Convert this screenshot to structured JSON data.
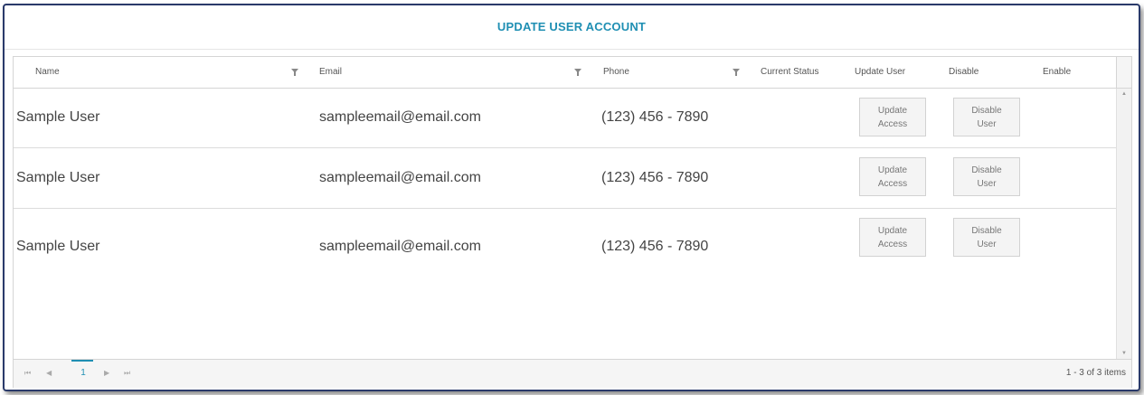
{
  "title": "UPDATE USER ACCOUNT",
  "columns": {
    "name": "Name",
    "email": "Email",
    "phone": "Phone",
    "status": "Current Status",
    "update": "Update User",
    "disable": "Disable",
    "enable": "Enable"
  },
  "rows": [
    {
      "name": "Sample User",
      "email": "sampleemail@email.com",
      "phone": "(123) 456 - 7890",
      "update_l1": "Update",
      "update_l2": "Access",
      "disable_l1": "Disable",
      "disable_l2": "User"
    },
    {
      "name": "Sample User",
      "email": "sampleemail@email.com",
      "phone": "(123) 456 - 7890",
      "update_l1": "Update",
      "update_l2": "Access",
      "disable_l1": "Disable",
      "disable_l2": "User"
    },
    {
      "name": "Sample User",
      "email": "sampleemail@email.com",
      "phone": "(123) 456 - 7890",
      "update_l1": "Update",
      "update_l2": "Access",
      "disable_l1": "Disable",
      "disable_l2": "User"
    }
  ],
  "pager": {
    "first": "⏮",
    "prev": "◀",
    "page": "1",
    "next": "▶",
    "last": "⏭",
    "info": "1 - 3 of 3 items"
  },
  "icons": {
    "filter": "filter-icon",
    "scroll_up": "▲",
    "scroll_down": "▼"
  },
  "colors": {
    "accent": "#1f8fb3",
    "border": "#2a3a6a"
  }
}
